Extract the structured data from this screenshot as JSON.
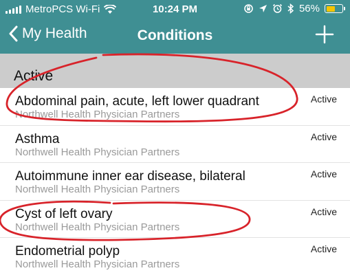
{
  "status_bar": {
    "carrier": "MetroPCS Wi-Fi",
    "time": "10:24 PM",
    "battery_percent": "56%",
    "battery_level": 0.56
  },
  "nav": {
    "back_label": "My Health",
    "title": "Conditions"
  },
  "section": {
    "title": "Active"
  },
  "conditions": [
    {
      "title": "Abdominal pain, acute, left lower quadrant",
      "provider": "Northwell Health Physician Partners",
      "status": "Active"
    },
    {
      "title": "Asthma",
      "provider": "Northwell Health Physician Partners",
      "status": "Active"
    },
    {
      "title": "Autoimmune inner ear disease, bilateral",
      "provider": "Northwell Health Physician Partners",
      "status": "Active"
    },
    {
      "title": "Cyst of left ovary",
      "provider": "Northwell Health Physician Partners",
      "status": "Active"
    },
    {
      "title": "Endometrial polyp",
      "provider": "Northwell Health Physician Partners",
      "status": "Active"
    }
  ],
  "colors": {
    "header": "#3f8f93",
    "section": "#cccccc",
    "annotation": "#d8232a",
    "battery": "#f5c400"
  }
}
